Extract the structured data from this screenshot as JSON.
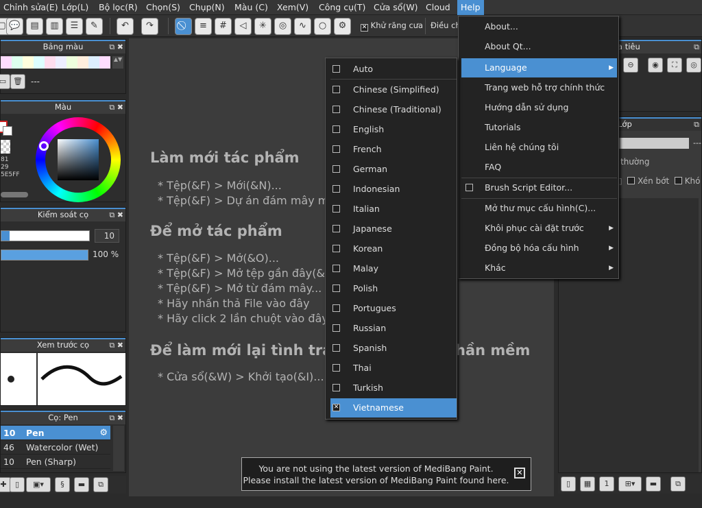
{
  "menubar": {
    "items": [
      "Chỉnh sửa(E)",
      "Lớp(L)",
      "Bộ lọc(R)",
      "Chọn(S)",
      "Chụp(N)",
      "Màu (C)",
      "Xem(V)",
      "Công cụ(T)",
      "Cửa sổ(W)",
      "Cloud",
      "Help"
    ],
    "active": "Help"
  },
  "toolbar": {
    "antialias_label": "Khử răng cưa",
    "antialias_checked": true,
    "adjust_label": "Điều ch"
  },
  "panels": {
    "palette": {
      "title": "Bảng màu",
      "value": "---"
    },
    "color": {
      "title": "Màu",
      "hex_fragment": "5E5FF",
      "nums": [
        "81",
        "29"
      ]
    },
    "brush_control": {
      "title": "Kiểm soát cọ",
      "size": "10",
      "opacity": "100 %"
    },
    "brush_preview": {
      "title": "Xem trước cọ"
    },
    "brush": {
      "title": "Cọ: Pen",
      "rows": [
        {
          "size": "10",
          "name": "Pen",
          "selected": true
        },
        {
          "size": "46",
          "name": "Watercolor (Wet)",
          "selected": false
        },
        {
          "size": "10",
          "name": "Pen (Sharp)",
          "selected": false
        }
      ]
    },
    "navigator": {
      "title_fragment": "a tiêu"
    },
    "layer": {
      "title_fragment": "Lớp",
      "dash": "---",
      "blend": "thường",
      "check1": "Xén bớt",
      "check2": "Khó"
    }
  },
  "welcome": {
    "section1_title": "Làm mới tác phẩm",
    "section1_lines": [
      "* Tệp(&F) > Mới(&N)...",
      "* Tệp(&F) > Dự án đám mây m"
    ],
    "section2_title": "Để mở tác phẩm",
    "section2_lines": [
      "* Tệp(&F) > Mở(&O)...",
      "* Tệp(&F) > Mở tệp gần đây(&",
      "* Tệp(&F) > Mở từ đám mây...",
      "* Hãy nhấn thả File vào đây",
      "* Hãy click 2 lần chuột vào đây"
    ],
    "section3_title_left": "Để làm mới lại tình tra",
    "section3_title_right": "hần mềm",
    "section3_lines": [
      "* Cửa sổ(&W) > Khởi tạo(&I)..."
    ]
  },
  "language_menu": {
    "items": [
      {
        "label": "Auto",
        "checked": false
      },
      {
        "label": "Chinese (Simplified)",
        "checked": false
      },
      {
        "label": "Chinese (Traditional)",
        "checked": false
      },
      {
        "label": "English",
        "checked": false
      },
      {
        "label": "French",
        "checked": false
      },
      {
        "label": "German",
        "checked": false
      },
      {
        "label": "Indonesian",
        "checked": false
      },
      {
        "label": "Italian",
        "checked": false
      },
      {
        "label": "Japanese",
        "checked": false
      },
      {
        "label": "Korean",
        "checked": false
      },
      {
        "label": "Malay",
        "checked": false
      },
      {
        "label": "Polish",
        "checked": false
      },
      {
        "label": "Portugues",
        "checked": false
      },
      {
        "label": "Russian",
        "checked": false
      },
      {
        "label": "Spanish",
        "checked": false
      },
      {
        "label": "Thai",
        "checked": false
      },
      {
        "label": "Turkish",
        "checked": false
      },
      {
        "label": "Vietnamese",
        "checked": true
      }
    ]
  },
  "help_menu": {
    "items": [
      {
        "label": "About...",
        "submenu": false
      },
      {
        "label": "About Qt...",
        "submenu": false
      },
      {
        "label": "Language",
        "submenu": true,
        "selected": true
      },
      {
        "label": "Trang web hỗ trợ chính thức",
        "submenu": false
      },
      {
        "label": "Hướng dẫn sử dụng",
        "submenu": false
      },
      {
        "label": "Tutorials",
        "submenu": false
      },
      {
        "label": "Liên hệ chúng tôi",
        "submenu": false
      },
      {
        "label": "FAQ",
        "submenu": false
      },
      {
        "label": "Brush Script Editor...",
        "submenu": false,
        "checkbox": true
      },
      {
        "label": "Mở thư mục cấu hình(C)...",
        "submenu": false
      },
      {
        "label": "Khôi phục cài đặt trước",
        "submenu": true
      },
      {
        "label": "Đồng bộ hóa cấu hình",
        "submenu": true
      },
      {
        "label": "Khác",
        "submenu": true
      }
    ]
  },
  "notice": {
    "line1": "You are not using the latest version of MediBang Paint.",
    "line2": "Please install the latest version of MediBang Paint found here."
  },
  "colors": {
    "accent": "#4a90d2",
    "panel_bg": "#2d2d2d",
    "menu_bg": "#232323"
  }
}
